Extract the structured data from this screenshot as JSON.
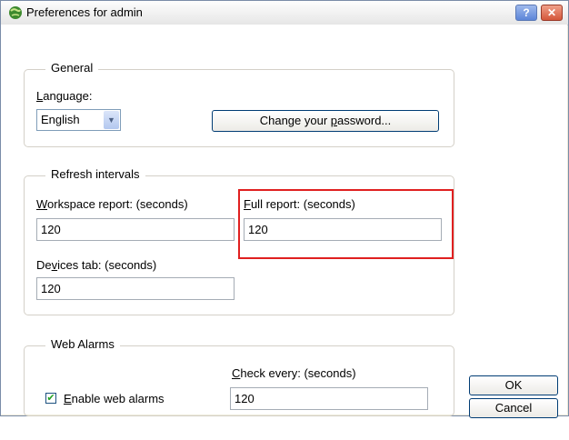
{
  "window": {
    "title": "Preferences for admin",
    "help_button": "?",
    "close_button": "✕"
  },
  "general": {
    "legend": "General",
    "language_label": "Language:",
    "language_value": "English",
    "change_password_button": "Change your password..."
  },
  "refresh": {
    "legend": "Refresh intervals",
    "workspace_label": "Workspace report: (seconds)",
    "workspace_value": "120",
    "full_label": "Full report: (seconds)",
    "full_value": "120",
    "devices_label": "Devices tab: (seconds)",
    "devices_value": "120"
  },
  "web_alarms": {
    "legend": "Web Alarms",
    "check_every_label": "Check every: (seconds)",
    "check_every_value": "120",
    "enable_label": "Enable web alarms",
    "enable_checked": true
  },
  "buttons": {
    "ok": "OK",
    "cancel": "Cancel"
  }
}
